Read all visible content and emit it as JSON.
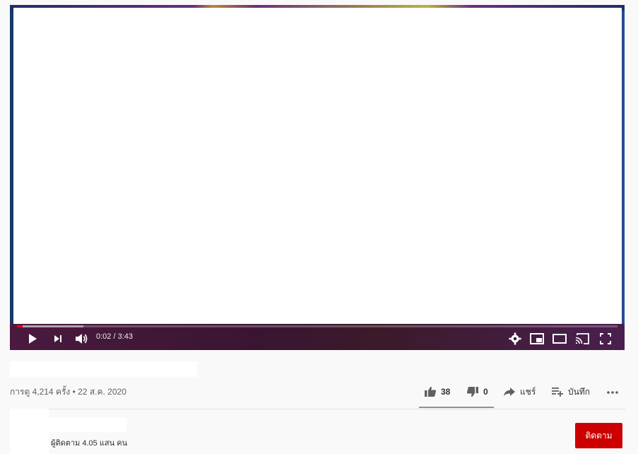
{
  "player": {
    "time_display": "0:02 / 3:43",
    "progress_fraction": 0.009,
    "buffer_fraction": 0.11,
    "icons": [
      "play-icon",
      "next-icon",
      "volume-icon",
      "settings-icon",
      "miniplayer-icon",
      "theater-icon",
      "cast-icon",
      "fullscreen-icon"
    ]
  },
  "video": {
    "title": "",
    "meta": "การดู 4,214 ครั้ง • 22 ส.ค. 2020"
  },
  "actions": {
    "like_count": "38",
    "dislike_count": "0",
    "share_label": "แชร์",
    "save_label": "บันทึก"
  },
  "channel": {
    "subscribers": "ผู้ติดตาม 4.05 แสน คน",
    "subscribe_label": "ติดตาม"
  },
  "colors": {
    "progress": "#ff0000",
    "subscribe": "#cc0000"
  }
}
